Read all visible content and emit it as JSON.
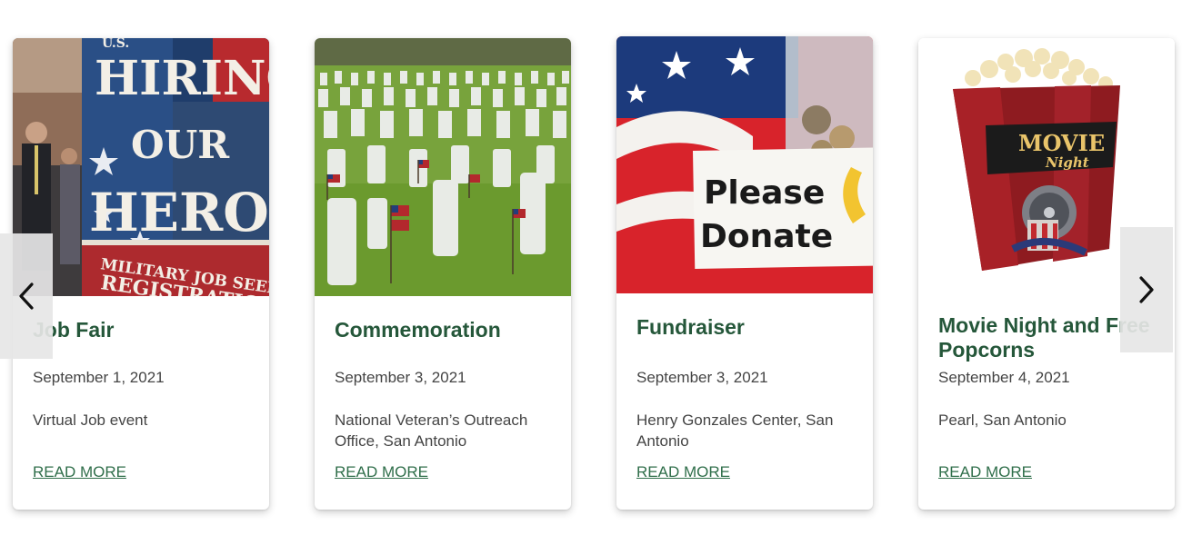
{
  "controls": {
    "prev_icon": "chevron-left-icon",
    "next_icon": "chevron-right-icon"
  },
  "events": [
    {
      "title": "Job Fair",
      "date": "September 1, 2021",
      "location": "Virtual Job event",
      "link": "READ MORE",
      "image_text": {
        "top": "U.S.",
        "line1": "HIRING",
        "line2": "OUR",
        "line3": "HEROES",
        "banner1": "MILITARY JOB SEEKER",
        "banner2": "REGISTRATION"
      }
    },
    {
      "title": "Commemoration",
      "date": "September 3, 2021",
      "location": "National Veteran’s Outreach Office, San Antonio",
      "link": "READ MORE"
    },
    {
      "title": "Fundraiser",
      "date": "September 3, 2021",
      "location": "Henry Gonzales Center, San Antonio",
      "link": "READ MORE",
      "image_text": {
        "line1": "Please",
        "line2": "Donate"
      }
    },
    {
      "title": "Movie Night and Free Popcorns",
      "date": "September 4, 2021",
      "location": "Pearl, San Antonio",
      "link": "READ MORE",
      "image_text": {
        "line1": "MOVIE",
        "line2": "Night"
      }
    }
  ],
  "colors": {
    "title": "#25573a",
    "link": "#2f6e4a",
    "body_text": "#444444"
  }
}
